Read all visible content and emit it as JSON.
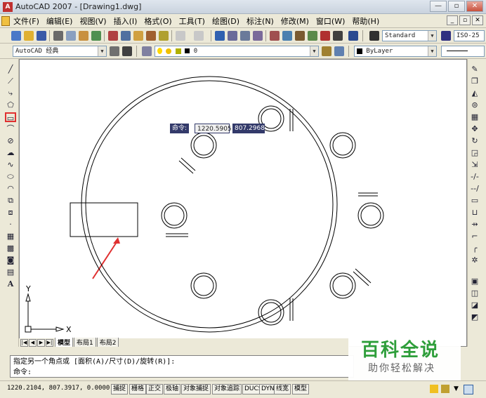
{
  "window": {
    "title": "AutoCAD 2007 - [Drawing1.dwg]",
    "app_icon": "A"
  },
  "menu": {
    "items": [
      "文件(F)",
      "编辑(E)",
      "视图(V)",
      "插入(I)",
      "格式(O)",
      "工具(T)",
      "绘图(D)",
      "标注(N)",
      "修改(M)",
      "窗口(W)",
      "帮助(H)"
    ]
  },
  "toolbar": {
    "text_style": "Standard",
    "dim_style": "ISO-25",
    "workspace": "AutoCAD 经典",
    "layer": "0",
    "color": "ByLayer"
  },
  "dynamic_input": {
    "label": "命令:",
    "x_value": "1220.5905",
    "y_value": "807.2968"
  },
  "ucs": {
    "x_label": "X",
    "y_label": "Y"
  },
  "layout_tabs": [
    "模型",
    "布局1",
    "布局2"
  ],
  "command": {
    "prompt_line": "指定另一个角点或 [面积(A)/尺寸(D)/旋转(R)]:",
    "input_label": "命令:"
  },
  "status": {
    "coordinates": "1220.2104,  807.3917,  0.0000",
    "toggles": [
      "捕捉",
      "栅格",
      "正交",
      "极轴",
      "对象捕捉",
      "对象追踪",
      "DUCS",
      "DYN",
      "线宽",
      "模型"
    ]
  },
  "watermark": {
    "title": "百科全说",
    "subtitle": "助你轻松解决"
  },
  "colors": {
    "accent_red": "#e03030",
    "watermark_green": "#2e9e3a",
    "tooltip_blue": "#333a6a"
  }
}
